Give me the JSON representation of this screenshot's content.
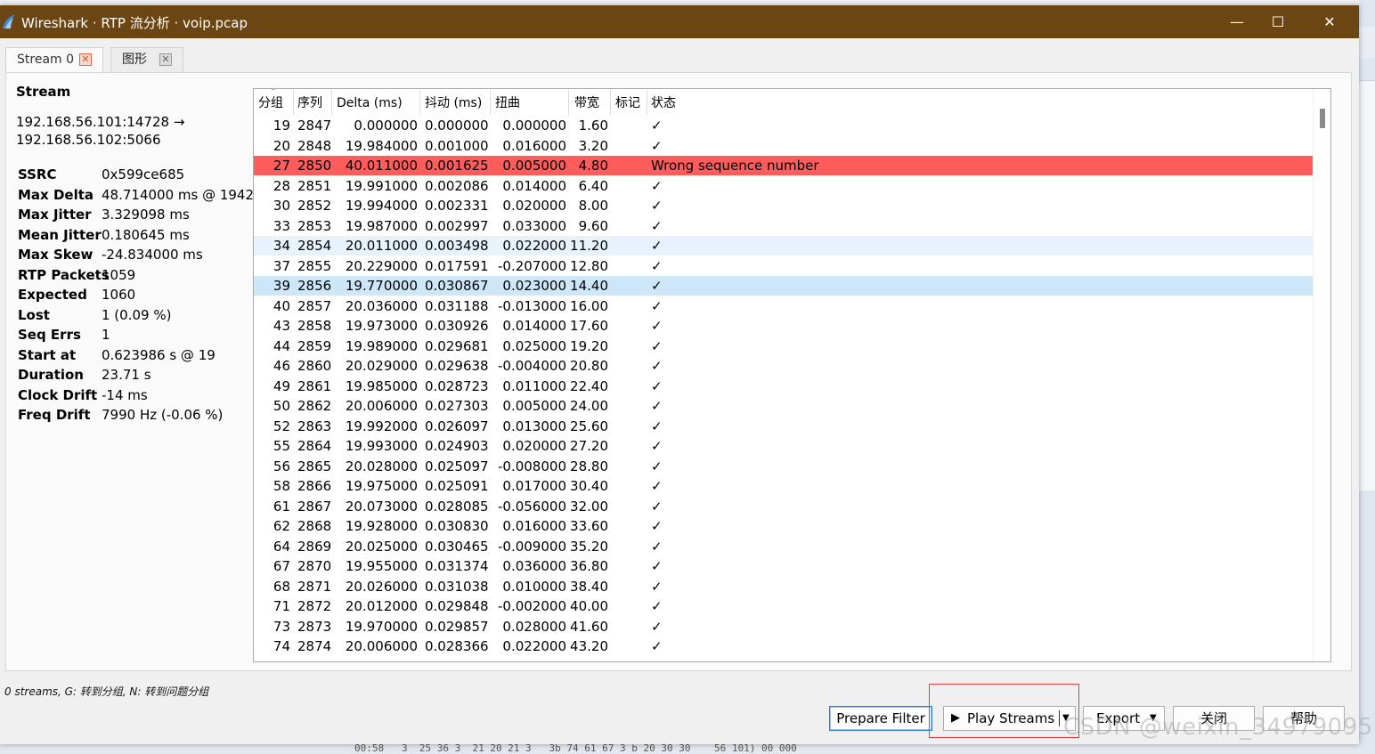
{
  "window": {
    "title": "Wireshark · RTP 流分析 · voip.pcap",
    "controls": {
      "minimize": "—",
      "maximize": "☐",
      "close": "✕"
    }
  },
  "tabs": [
    {
      "label": "Stream 0"
    },
    {
      "label": "图形"
    }
  ],
  "stream_panel": {
    "heading": "Stream",
    "endpoint_from": "192.168.56.101:14728 →",
    "endpoint_to": "192.168.56.102:5066",
    "stats": [
      {
        "key": "SSRC",
        "value": "0x599ce685"
      },
      {
        "key": "Max Delta",
        "value": "48.714000 ms @ 1942"
      },
      {
        "key": "Max Jitter",
        "value": "3.329098 ms"
      },
      {
        "key": "Mean Jitter",
        "value": "0.180645 ms"
      },
      {
        "key": "Max Skew",
        "value": "-24.834000 ms"
      },
      {
        "key": "RTP Packets",
        "value": "1059"
      },
      {
        "key": "Expected",
        "value": "1060"
      },
      {
        "key": "Lost",
        "value": "1 (0.09 %)"
      },
      {
        "key": "Seq Errs",
        "value": "1"
      },
      {
        "key": "Start at",
        "value": "0.623986 s @ 19"
      },
      {
        "key": "Duration",
        "value": "23.71 s"
      },
      {
        "key": "Clock Drift",
        "value": "-14 ms"
      },
      {
        "key": "Freq Drift",
        "value": "7990 Hz (-0.06 %)"
      }
    ]
  },
  "table": {
    "columns": [
      "分组",
      "序列",
      "Delta (ms)",
      "抖动 (ms)",
      "扭曲",
      "带宽",
      "标记",
      "状态"
    ],
    "rows": [
      {
        "pkt": "19",
        "seq": "2847",
        "delta": "0.000000",
        "jitter": "0.000000",
        "skew": "0.000000",
        "bw": "1.60",
        "mark": "",
        "status": "✓",
        "state": "normal"
      },
      {
        "pkt": "20",
        "seq": "2848",
        "delta": "19.984000",
        "jitter": "0.001000",
        "skew": "0.016000",
        "bw": "3.20",
        "mark": "",
        "status": "✓",
        "state": "normal"
      },
      {
        "pkt": "27",
        "seq": "2850",
        "delta": "40.011000",
        "jitter": "0.001625",
        "skew": "0.005000",
        "bw": "4.80",
        "mark": "",
        "status": "Wrong sequence number",
        "state": "error"
      },
      {
        "pkt": "28",
        "seq": "2851",
        "delta": "19.991000",
        "jitter": "0.002086",
        "skew": "0.014000",
        "bw": "6.40",
        "mark": "",
        "status": "✓",
        "state": "normal"
      },
      {
        "pkt": "30",
        "seq": "2852",
        "delta": "19.994000",
        "jitter": "0.002331",
        "skew": "0.020000",
        "bw": "8.00",
        "mark": "",
        "status": "✓",
        "state": "normal"
      },
      {
        "pkt": "33",
        "seq": "2853",
        "delta": "19.987000",
        "jitter": "0.002997",
        "skew": "0.033000",
        "bw": "9.60",
        "mark": "",
        "status": "✓",
        "state": "normal"
      },
      {
        "pkt": "34",
        "seq": "2854",
        "delta": "20.011000",
        "jitter": "0.003498",
        "skew": "0.022000",
        "bw": "11.20",
        "mark": "",
        "status": "✓",
        "state": "hover"
      },
      {
        "pkt": "37",
        "seq": "2855",
        "delta": "20.229000",
        "jitter": "0.017591",
        "skew": "-0.207000",
        "bw": "12.80",
        "mark": "",
        "status": "✓",
        "state": "normal"
      },
      {
        "pkt": "39",
        "seq": "2856",
        "delta": "19.770000",
        "jitter": "0.030867",
        "skew": "0.023000",
        "bw": "14.40",
        "mark": "",
        "status": "✓",
        "state": "selected"
      },
      {
        "pkt": "40",
        "seq": "2857",
        "delta": "20.036000",
        "jitter": "0.031188",
        "skew": "-0.013000",
        "bw": "16.00",
        "mark": "",
        "status": "✓",
        "state": "normal"
      },
      {
        "pkt": "43",
        "seq": "2858",
        "delta": "19.973000",
        "jitter": "0.030926",
        "skew": "0.014000",
        "bw": "17.60",
        "mark": "",
        "status": "✓",
        "state": "normal"
      },
      {
        "pkt": "44",
        "seq": "2859",
        "delta": "19.989000",
        "jitter": "0.029681",
        "skew": "0.025000",
        "bw": "19.20",
        "mark": "",
        "status": "✓",
        "state": "normal"
      },
      {
        "pkt": "46",
        "seq": "2860",
        "delta": "20.029000",
        "jitter": "0.029638",
        "skew": "-0.004000",
        "bw": "20.80",
        "mark": "",
        "status": "✓",
        "state": "normal"
      },
      {
        "pkt": "49",
        "seq": "2861",
        "delta": "19.985000",
        "jitter": "0.028723",
        "skew": "0.011000",
        "bw": "22.40",
        "mark": "",
        "status": "✓",
        "state": "normal"
      },
      {
        "pkt": "50",
        "seq": "2862",
        "delta": "20.006000",
        "jitter": "0.027303",
        "skew": "0.005000",
        "bw": "24.00",
        "mark": "",
        "status": "✓",
        "state": "normal"
      },
      {
        "pkt": "52",
        "seq": "2863",
        "delta": "19.992000",
        "jitter": "0.026097",
        "skew": "0.013000",
        "bw": "25.60",
        "mark": "",
        "status": "✓",
        "state": "normal"
      },
      {
        "pkt": "55",
        "seq": "2864",
        "delta": "19.993000",
        "jitter": "0.024903",
        "skew": "0.020000",
        "bw": "27.20",
        "mark": "",
        "status": "✓",
        "state": "normal"
      },
      {
        "pkt": "56",
        "seq": "2865",
        "delta": "20.028000",
        "jitter": "0.025097",
        "skew": "-0.008000",
        "bw": "28.80",
        "mark": "",
        "status": "✓",
        "state": "normal"
      },
      {
        "pkt": "58",
        "seq": "2866",
        "delta": "19.975000",
        "jitter": "0.025091",
        "skew": "0.017000",
        "bw": "30.40",
        "mark": "",
        "status": "✓",
        "state": "normal"
      },
      {
        "pkt": "61",
        "seq": "2867",
        "delta": "20.073000",
        "jitter": "0.028085",
        "skew": "-0.056000",
        "bw": "32.00",
        "mark": "",
        "status": "✓",
        "state": "normal"
      },
      {
        "pkt": "62",
        "seq": "2868",
        "delta": "19.928000",
        "jitter": "0.030830",
        "skew": "0.016000",
        "bw": "33.60",
        "mark": "",
        "status": "✓",
        "state": "normal"
      },
      {
        "pkt": "64",
        "seq": "2869",
        "delta": "20.025000",
        "jitter": "0.030465",
        "skew": "-0.009000",
        "bw": "35.20",
        "mark": "",
        "status": "✓",
        "state": "normal"
      },
      {
        "pkt": "67",
        "seq": "2870",
        "delta": "19.955000",
        "jitter": "0.031374",
        "skew": "0.036000",
        "bw": "36.80",
        "mark": "",
        "status": "✓",
        "state": "normal"
      },
      {
        "pkt": "68",
        "seq": "2871",
        "delta": "20.026000",
        "jitter": "0.031038",
        "skew": "0.010000",
        "bw": "38.40",
        "mark": "",
        "status": "✓",
        "state": "normal"
      },
      {
        "pkt": "71",
        "seq": "2872",
        "delta": "20.012000",
        "jitter": "0.029848",
        "skew": "-0.002000",
        "bw": "40.00",
        "mark": "",
        "status": "✓",
        "state": "normal"
      },
      {
        "pkt": "73",
        "seq": "2873",
        "delta": "19.970000",
        "jitter": "0.029857",
        "skew": "0.028000",
        "bw": "41.60",
        "mark": "",
        "status": "✓",
        "state": "normal"
      },
      {
        "pkt": "74",
        "seq": "2874",
        "delta": "20.006000",
        "jitter": "0.028366",
        "skew": "0.022000",
        "bw": "43.20",
        "mark": "",
        "status": "✓",
        "state": "normal"
      }
    ]
  },
  "status_line": "0 streams, G: 转到分组,   N: 转到问题分组",
  "buttons": {
    "prepare_filter": "Prepare Filter",
    "play_streams": "Play Streams",
    "export": "Export",
    "close": "关闭",
    "help": "帮助"
  },
  "icons": {
    "play": "▶",
    "dropdown": "▼",
    "tab_close": "✕",
    "check": "✓"
  },
  "watermark": "CSDN @weixin_34979095",
  "background_text": "00:58   3  25 36 3  21 20 21 3   3b 74 61 67 3 b 20 30 30    56 101) 00 000",
  "colors": {
    "titlebar": "#6b4512",
    "error_row": "#ff5c5c",
    "selected_row": "#cde6f8",
    "hover_row": "#e7f2fd",
    "highlight_box": "#e04040"
  }
}
